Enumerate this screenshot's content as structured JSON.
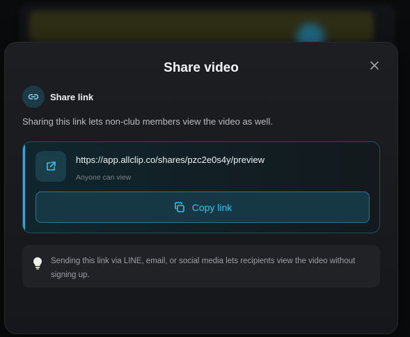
{
  "dialog": {
    "title": "Share video",
    "section_label": "Share link",
    "description": "Sharing this link lets non-club members view the video as well.",
    "link": {
      "url": "https://app.allclip.co/shares/pzc2e0s4y/preview",
      "permission_note": "Anyone can view",
      "copy_label": "Copy link"
    },
    "tip": "Sending this link via LINE, email, or social media lets recipients view the video without signing up."
  },
  "icons": {
    "close": "close-icon",
    "section": "link-icon",
    "open": "external-link-icon",
    "copy": "copy-icon",
    "tip": "lightbulb-icon"
  },
  "colors": {
    "accent": "#2aa9d8",
    "accent_text": "#3cc2f0",
    "dialog_bg": "#1c1e22"
  }
}
